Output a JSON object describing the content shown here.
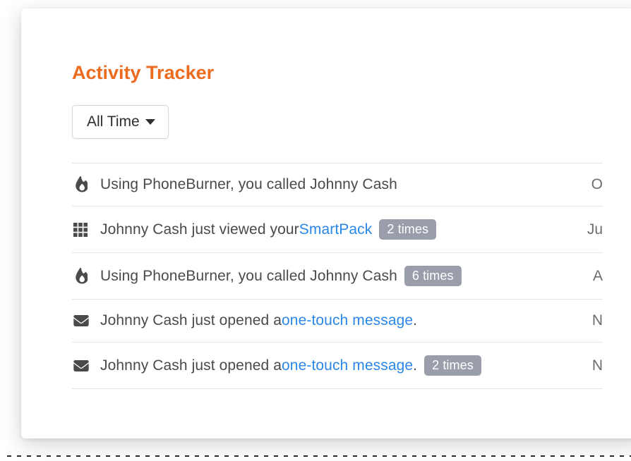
{
  "title": "Activity Tracker",
  "filter": {
    "selected": "All Time"
  },
  "activities": [
    {
      "icon": "fire",
      "pre": "Using PhoneBurner, you called Johnny Cash",
      "link": "",
      "post": "",
      "badge": "",
      "date": "O"
    },
    {
      "icon": "grid",
      "pre": "Johnny Cash just viewed your ",
      "link": "SmartPack",
      "post": "",
      "badge": "2 times",
      "date": "Ju"
    },
    {
      "icon": "fire",
      "pre": "Using PhoneBurner, you called Johnny Cash",
      "link": "",
      "post": "",
      "badge": "6 times",
      "date": "A"
    },
    {
      "icon": "envelope",
      "pre": "Johnny Cash just opened a ",
      "link": "one-touch message",
      "post": ".",
      "badge": "",
      "date": "N"
    },
    {
      "icon": "envelope",
      "pre": "Johnny Cash just opened a ",
      "link": "one-touch message",
      "post": ".",
      "badge": "2 times",
      "date": "N"
    }
  ]
}
